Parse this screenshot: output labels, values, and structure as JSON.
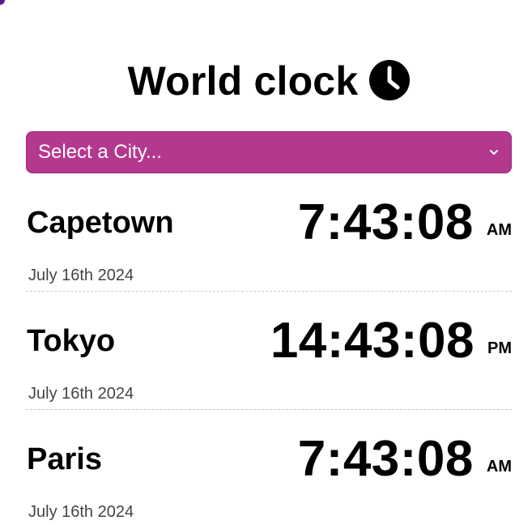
{
  "header": {
    "title": "World clock",
    "icon": "clock-icon"
  },
  "city_select": {
    "selected_label": "Select a City...",
    "icon": "chevron-down-icon",
    "background_color": "#b5388f"
  },
  "cities": [
    {
      "name": "Capetown",
      "time": "7:43:08",
      "ampm": "AM",
      "date": "July 16th 2024"
    },
    {
      "name": "Tokyo",
      "time": "14:43:08",
      "ampm": "PM",
      "date": "July 16th 2024"
    },
    {
      "name": "Paris",
      "time": "7:43:08",
      "ampm": "AM",
      "date": "July 16th 2024"
    }
  ]
}
